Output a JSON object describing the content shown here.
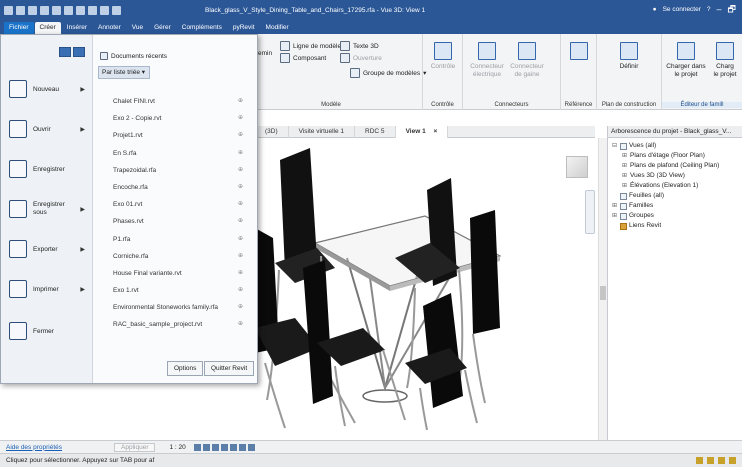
{
  "titlebar": {
    "document_title": "Black_glass_V_Style_Dining_Table_and_Chairs_17295.rfa - Vue 3D: View 1",
    "connect_label": "Se connecter",
    "minimize": "–",
    "restore": "🗗"
  },
  "menu_tabs": [
    "Fichier",
    "Créer",
    "Insérer",
    "Annoter",
    "Vue",
    "Gérer",
    "Compléments",
    "pyRevit",
    "Modifier"
  ],
  "ribbon": {
    "model_group": {
      "title": "Modèle",
      "chemin": "emin",
      "ligne_de_modele": "Ligne de modèle",
      "texte_3d": "Texte 3D",
      "composant": "Composant",
      "ouverture": "Ouverture",
      "groupe_de_modeles": "Groupe de modèles"
    },
    "controle_group": {
      "title": "Contrôle",
      "button": "Contrôle"
    },
    "connecteurs_group": {
      "title": "Connecteurs",
      "connecteur_electrique_top": "Connecteur",
      "connecteur_electrique_bottom": "électrique",
      "connecteur_gaine_top": "Connecteur",
      "connecteur_gaine_bottom": "de gaine"
    },
    "reference_group": {
      "title": "Référence"
    },
    "plan_group": {
      "title": "Plan de construction",
      "button": "Définir"
    },
    "editeur_group": {
      "title": "Éditeur de famill",
      "charger_dans_projet_top": "Charger dans",
      "charger_dans_projet_bottom": "le projet",
      "charger_suite_top": "Charg",
      "charger_suite_bottom": "le projet"
    }
  },
  "view_tabs": [
    {
      "label": "(3D)"
    },
    {
      "label": "Visite virtuelle 1"
    },
    {
      "label": "RDC 5"
    },
    {
      "label": "View 1",
      "active": true
    }
  ],
  "view_tab_close": "×",
  "project_browser": {
    "title": "Arborescence du projet - Black_glass_V...",
    "tree": [
      {
        "label": "Vues (all)",
        "level": 0,
        "toggle": "⊟"
      },
      {
        "label": "Plans d'étage (Floor Plan)",
        "level": 1,
        "toggle": "⊞"
      },
      {
        "label": "Plans de plafond (Ceiling Plan)",
        "level": 1,
        "toggle": "⊞"
      },
      {
        "label": "Vues 3D (3D View)",
        "level": 1,
        "toggle": "⊞"
      },
      {
        "label": "Élévations (Elevation 1)",
        "level": 1,
        "toggle": "⊞"
      },
      {
        "label": "Feuilles (all)",
        "level": 0,
        "toggle": ""
      },
      {
        "label": "Familles",
        "level": 0,
        "toggle": "⊞"
      },
      {
        "label": "Groupes",
        "level": 0,
        "toggle": "⊞"
      },
      {
        "label": "Liens Revit",
        "level": 0,
        "toggle": ""
      }
    ]
  },
  "app_menu": {
    "items": [
      {
        "label": "Nouveau",
        "arrow": true
      },
      {
        "label": "Ouvrir",
        "arrow": true
      },
      {
        "label": "Enregistrer",
        "arrow": false
      },
      {
        "label": "Enregistrer sous",
        "arrow": true
      },
      {
        "label": "Exporter",
        "arrow": true
      },
      {
        "label": "Imprimer",
        "arrow": true
      },
      {
        "label": "Fermer",
        "arrow": false
      }
    ],
    "recent_header": "Documents récents",
    "sort_label": "Par liste triée",
    "recent_docs": [
      "Chalet FINI.rvt",
      "Exo 2 - Copie.rvt",
      "Projet1.rvt",
      "En S.rfa",
      "Trapezoidal.rfa",
      "Encoche.rfa",
      "Exo 01.rvt",
      "Phases.rvt",
      "P1.rfa",
      "Corniche.rfa",
      "House Final variante.rvt",
      "Exo 1.rvt",
      "Environmental Stoneworks family.rfa",
      "RAC_basic_sample_project.rvt"
    ],
    "pin_glyph": "⊕",
    "options_label": "Options",
    "quit_label": "Quitter Revit"
  },
  "view_control": {
    "properties_link": "Aide des propriétés",
    "apply_label": "Appliquer",
    "scale": "1 : 20"
  },
  "status": {
    "text": "Cliquez pour sélectionner. Appuyez sur TAB pour af"
  },
  "colors": {
    "title_blue": "#2b5797",
    "file_tab": "#1a73c9",
    "ribbon_bg": "#f3f4f5"
  }
}
